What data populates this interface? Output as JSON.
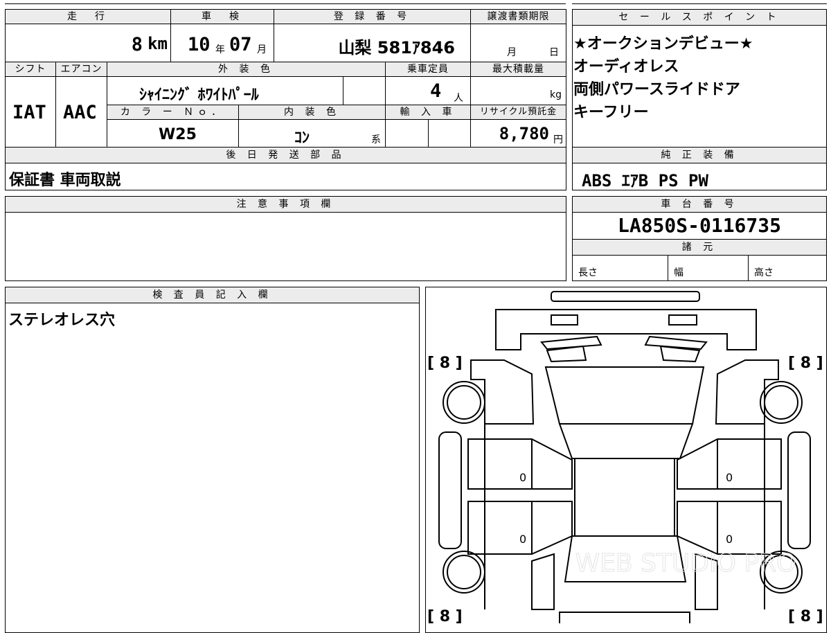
{
  "headers": {
    "mileage": "走　行",
    "inspection": "車　検",
    "registration": "登 録 番 号",
    "transfer_deadline": "譲渡書類期限",
    "shift": "シフト",
    "aircon": "エアコン",
    "exterior_color": "外 装 色",
    "capacity": "乗車定員",
    "max_load": "最大積載量",
    "color_no": "カ ラ ー Ｎｏ．",
    "interior_color": "内 装 色",
    "import": "輸 入 車",
    "recycle": "リサイクル預託金",
    "later_parts": "後 日 発 送 部 品",
    "sales_points": "セ ー ル ス ポ イ ン ト",
    "genuine_equipment": "純 正 装 備",
    "notes": "注 意 事 項 欄",
    "chassis_no": "車 台 番 号",
    "specs": "諸 元",
    "inspector": "検 査 員 記 入 欄"
  },
  "values": {
    "mileage": "8",
    "mileage_unit": "km",
    "inspection_year": "10",
    "year_unit": "年",
    "inspection_month": "07",
    "month_unit": "月",
    "registration": "山梨 581ｱ846",
    "transfer_month_unit": "月",
    "transfer_day_unit": "日",
    "shift": "IAT",
    "aircon": "AAC",
    "exterior_color": "ｼｬｲﾆﾝｸﾞ ﾎﾜｲﾄﾊﾟｰﾙ",
    "capacity": "4",
    "capacity_unit": "人",
    "max_load_unit": "kg",
    "color_no": "W25",
    "interior_color": "ｺﾝ",
    "interior_suffix": "系",
    "recycle": "8,780",
    "recycle_unit": "円",
    "later_parts": "保証書 車両取説",
    "chassis_no": "LA850S-0116735",
    "spec_length": "長さ",
    "spec_width": "幅",
    "spec_height": "高さ",
    "inspector_note": "ステレオレス穴"
  },
  "sales_points": [
    "★オークションデビュー★",
    "オーディオレス",
    "両側パワースライドドア",
    "キーフリー"
  ],
  "genuine_equipment": "ABS ｴｱB PS PW",
  "tires": {
    "front_left": "[ 8 ]",
    "front_right": "[ 8 ]",
    "rear_left": "[ 8 ]",
    "rear_right": "[ 8 ]"
  },
  "door_marks": [
    "0",
    "0",
    "0",
    "0"
  ],
  "watermark": "WEB STUDIO PRO"
}
